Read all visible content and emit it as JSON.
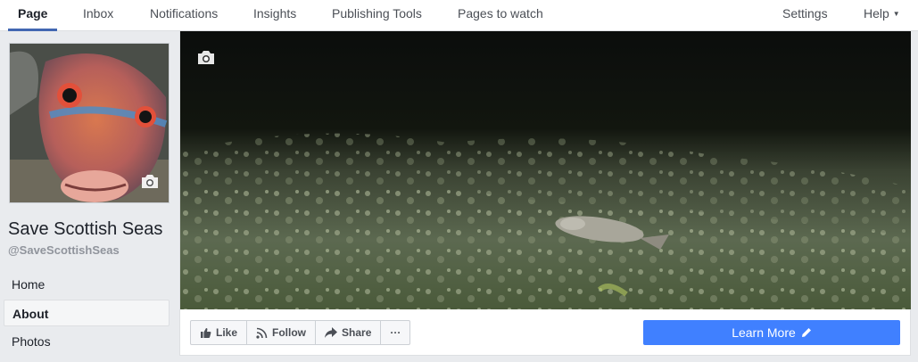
{
  "topnav": {
    "tabs": [
      {
        "label": "Page",
        "active": true
      },
      {
        "label": "Inbox"
      },
      {
        "label": "Notifications"
      },
      {
        "label": "Insights"
      },
      {
        "label": "Publishing Tools"
      },
      {
        "label": "Pages to watch"
      }
    ],
    "settings": "Settings",
    "help": "Help"
  },
  "page": {
    "name": "Save Scottish Seas",
    "handle": "@SaveScottishSeas"
  },
  "sidebar": {
    "items": [
      {
        "label": "Home"
      },
      {
        "label": "About",
        "active": true
      },
      {
        "label": "Photos"
      }
    ]
  },
  "actions": {
    "like": "Like",
    "follow": "Follow",
    "share": "Share",
    "more": "···",
    "cta": "Learn More"
  },
  "colors": {
    "accent": "#4267b2",
    "cta": "#4080ff",
    "background": "#e9ebee"
  }
}
